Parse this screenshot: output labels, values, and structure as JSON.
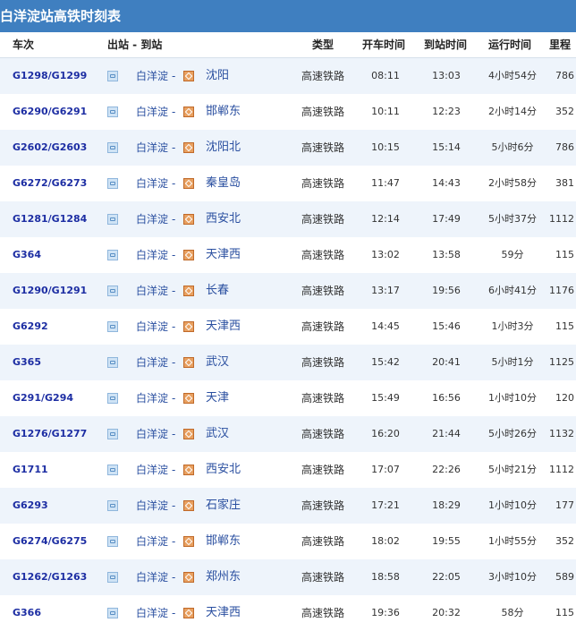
{
  "title": "白洋淀站高铁时刻表",
  "headers": {
    "train": "车次",
    "fromto": "出站 - 到站",
    "type": "类型",
    "dep": "开车时间",
    "arr": "到站时间",
    "dur": "运行时间",
    "dist": "里程"
  },
  "dash": "-",
  "rows": [
    {
      "train": "G1298/G1299",
      "from": "白洋淀",
      "to": "沈阳",
      "type": "高速铁路",
      "dep": "08:11",
      "arr": "13:03",
      "dur": "4小时54分",
      "dist": "786"
    },
    {
      "train": "G6290/G6291",
      "from": "白洋淀",
      "to": "邯郸东",
      "type": "高速铁路",
      "dep": "10:11",
      "arr": "12:23",
      "dur": "2小时14分",
      "dist": "352"
    },
    {
      "train": "G2602/G2603",
      "from": "白洋淀",
      "to": "沈阳北",
      "type": "高速铁路",
      "dep": "10:15",
      "arr": "15:14",
      "dur": "5小时6分",
      "dist": "786"
    },
    {
      "train": "G6272/G6273",
      "from": "白洋淀",
      "to": "秦皇岛",
      "type": "高速铁路",
      "dep": "11:47",
      "arr": "14:43",
      "dur": "2小时58分",
      "dist": "381"
    },
    {
      "train": "G1281/G1284",
      "from": "白洋淀",
      "to": "西安北",
      "type": "高速铁路",
      "dep": "12:14",
      "arr": "17:49",
      "dur": "5小时37分",
      "dist": "1112"
    },
    {
      "train": "G364",
      "from": "白洋淀",
      "to": "天津西",
      "type": "高速铁路",
      "dep": "13:02",
      "arr": "13:58",
      "dur": "59分",
      "dist": "115"
    },
    {
      "train": "G1290/G1291",
      "from": "白洋淀",
      "to": "长春",
      "type": "高速铁路",
      "dep": "13:17",
      "arr": "19:56",
      "dur": "6小时41分",
      "dist": "1176"
    },
    {
      "train": "G6292",
      "from": "白洋淀",
      "to": "天津西",
      "type": "高速铁路",
      "dep": "14:45",
      "arr": "15:46",
      "dur": "1小时3分",
      "dist": "115"
    },
    {
      "train": "G365",
      "from": "白洋淀",
      "to": "武汉",
      "type": "高速铁路",
      "dep": "15:42",
      "arr": "20:41",
      "dur": "5小时1分",
      "dist": "1125"
    },
    {
      "train": "G291/G294",
      "from": "白洋淀",
      "to": "天津",
      "type": "高速铁路",
      "dep": "15:49",
      "arr": "16:56",
      "dur": "1小时10分",
      "dist": "120"
    },
    {
      "train": "G1276/G1277",
      "from": "白洋淀",
      "to": "武汉",
      "type": "高速铁路",
      "dep": "16:20",
      "arr": "21:44",
      "dur": "5小时26分",
      "dist": "1132"
    },
    {
      "train": "G1711",
      "from": "白洋淀",
      "to": "西安北",
      "type": "高速铁路",
      "dep": "17:07",
      "arr": "22:26",
      "dur": "5小时21分",
      "dist": "1112"
    },
    {
      "train": "G6293",
      "from": "白洋淀",
      "to": "石家庄",
      "type": "高速铁路",
      "dep": "17:21",
      "arr": "18:29",
      "dur": "1小时10分",
      "dist": "177"
    },
    {
      "train": "G6274/G6275",
      "from": "白洋淀",
      "to": "邯郸东",
      "type": "高速铁路",
      "dep": "18:02",
      "arr": "19:55",
      "dur": "1小时55分",
      "dist": "352"
    },
    {
      "train": "G1262/G1263",
      "from": "白洋淀",
      "to": "郑州东",
      "type": "高速铁路",
      "dep": "18:58",
      "arr": "22:05",
      "dur": "3小时10分",
      "dist": "589"
    },
    {
      "train": "G366",
      "from": "白洋淀",
      "to": "天津西",
      "type": "高速铁路",
      "dep": "19:36",
      "arr": "20:32",
      "dur": "58分",
      "dist": "115"
    }
  ]
}
